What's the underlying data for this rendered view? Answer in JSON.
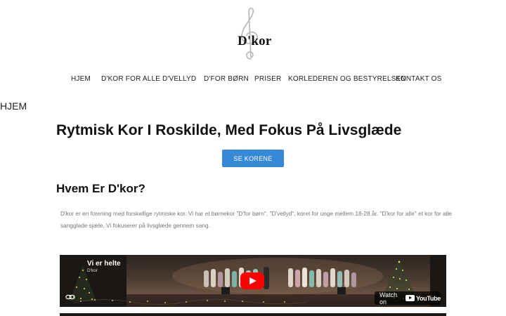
{
  "logo": {
    "text": "D'kor"
  },
  "nav": {
    "items": [
      {
        "label": "HJEM",
        "active": true
      },
      {
        "label": "D'KOR FOR ALLE",
        "active": false
      },
      {
        "label": "D'VELLYD",
        "active": false
      },
      {
        "label": "D'FOR BØRN",
        "active": false
      },
      {
        "label": "PRISER",
        "active": false
      },
      {
        "label": "KORLEDEREN OG BESTYRELSEN",
        "active": false
      },
      {
        "label": "KONTAKT OS",
        "active": false
      }
    ],
    "active_color": "#3a80c4"
  },
  "breadcrumb": "HJEM",
  "hero": {
    "title": "Rytmisk Kor I Roskilde, Med Fokus På Livsglæde",
    "cta_label": "SE KORENE",
    "cta_color": "#3689d6"
  },
  "about": {
    "title": "Hvem Er D'kor?",
    "paragraph": "D'kor er en forening med forskellige rytmiske kor. Vi har et børnekor \"D'for børn\", \"D'vellyd\", koret for unge mellem 18-28 år. \"D'kor for alle\" et kor for alle sangglade sjæle. Vi fokuserer på livsglæde gennem sang."
  },
  "video": {
    "title": "Vi er helte",
    "channel": "D'kor",
    "watch_label": "Watch on",
    "platform": "YouTube",
    "play_icon": "play-icon",
    "link_icon": "link-icon"
  }
}
